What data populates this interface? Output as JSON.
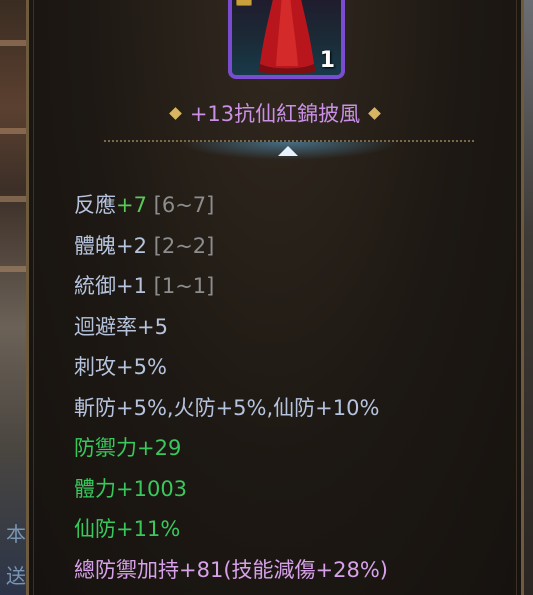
{
  "item": {
    "name": "+13抗仙紅錦披風",
    "stack_count": "1",
    "icon": "red-cape-icon"
  },
  "background": {
    "left_glyphs": [
      "本",
      "送"
    ]
  },
  "stats": [
    {
      "label": "反應",
      "bonus": "+7",
      "range": "[6~7]"
    },
    {
      "label": "體魄",
      "bonus": "+2",
      "range": "[2~2]"
    },
    {
      "label": "統御",
      "bonus": "+1",
      "range": "[1~1]"
    },
    {
      "text": "迴避率+5"
    },
    {
      "text": "刺攻+5%"
    },
    {
      "text": "斬防+5%,火防+5%,仙防+10%"
    },
    {
      "text": "防禦力+29"
    },
    {
      "text": "體力+1003"
    },
    {
      "text": "仙防+11%"
    },
    {
      "text": "總防禦加持+81(技能減傷+28%)"
    }
  ],
  "colors": {
    "base_stat": "#b5c3dd",
    "refine_bonus": "#59c95a",
    "range": "#8d8d8d",
    "enhanced_stat": "#38c85b",
    "set_bonus": "#d7a1ea",
    "title": "#c990e6",
    "icon_border": "#7a4ccf"
  }
}
